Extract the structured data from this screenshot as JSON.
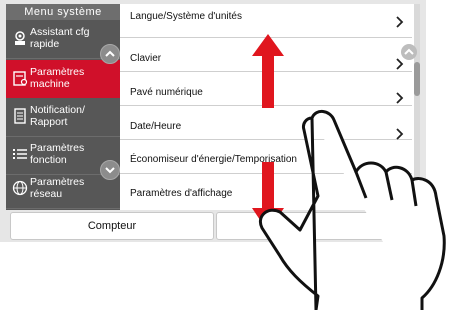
{
  "sidebar": {
    "title": "Menu système",
    "items": [
      {
        "label": "Assistant cfg rapide",
        "icon": "quick-setup-icon"
      },
      {
        "label": "Paramètres machine",
        "icon": "machine-settings-icon",
        "active": true
      },
      {
        "label": "Notification/ Rapport",
        "icon": "report-icon"
      },
      {
        "label": "Paramètres fonction",
        "icon": "function-list-icon"
      },
      {
        "label": "Paramètres réseau",
        "icon": "network-globe-icon"
      }
    ]
  },
  "menu_list": {
    "items": [
      {
        "label": "Langue/Système d'unités"
      },
      {
        "label": "Clavier"
      },
      {
        "label": "Pavé numérique"
      },
      {
        "label": "Date/Heure"
      },
      {
        "label": "Économiseur d'énergie/Temporisation"
      },
      {
        "label": "Paramètres d'affichage"
      }
    ]
  },
  "bottom_bar": {
    "counter_label": "Compteur"
  },
  "colors": {
    "active_red": "#d0102a",
    "sidebar_gray": "#575757",
    "gesture_arrow_red": "#e0161e"
  },
  "icons": [
    "chevron-right-icon",
    "scroll-up-icon",
    "scroll-down-icon",
    "hand-swipe-icon",
    "home-icon"
  ]
}
